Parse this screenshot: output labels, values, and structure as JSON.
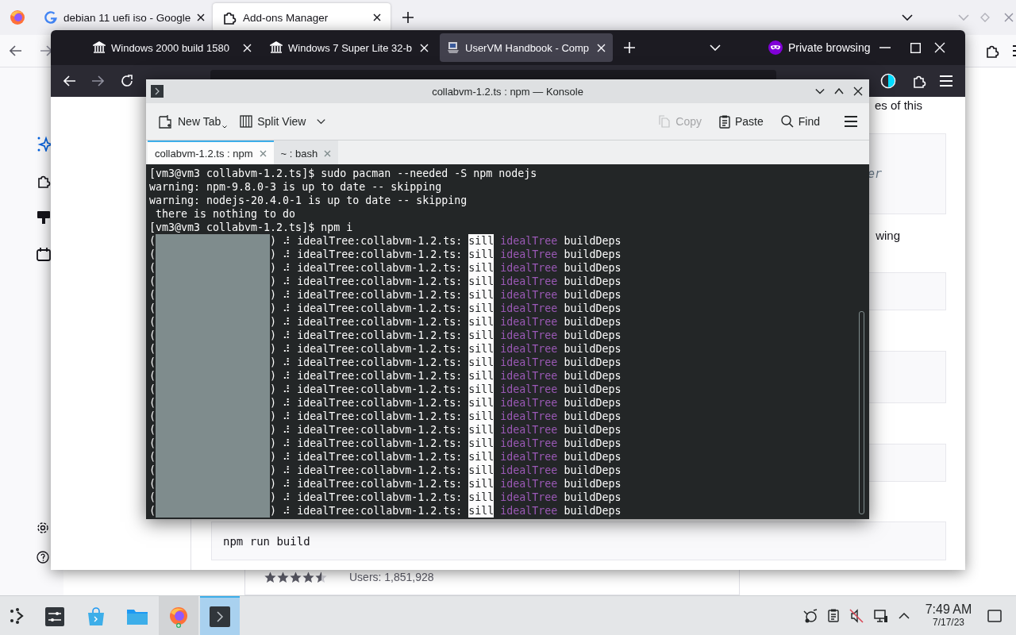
{
  "back_browser": {
    "tabs": [
      {
        "title": "debian 11 uefi iso - Google",
        "selected": false
      },
      {
        "title": "Add-ons Manager",
        "selected": true
      }
    ],
    "addon_card": {
      "stars": 4.5,
      "users": "Users: 1,851,928"
    }
  },
  "private_browser": {
    "tabs": [
      {
        "title": "Windows 2000 build 1580",
        "selected": false
      },
      {
        "title": "Windows 7 Super Lite 32-b",
        "selected": false
      },
      {
        "title": "UserVM Handbook - Comp",
        "selected": true
      }
    ],
    "private_label": "Private browsing",
    "page": {
      "paragraph_1": "es of this",
      "code_1": "er",
      "paragraph_2": "wing",
      "code_5": "npm run build"
    }
  },
  "konsole": {
    "title": "collabvm-1.2.ts : npm — Konsole",
    "toolbar": [
      {
        "label": "New Tab",
        "disabled": false
      },
      {
        "label": "Split View",
        "disabled": false
      },
      {
        "label": "Copy",
        "disabled": true
      },
      {
        "label": "Paste",
        "disabled": false
      },
      {
        "label": "Find",
        "disabled": false
      }
    ],
    "tabs": [
      {
        "label": "collabvm-1.2.ts : npm",
        "selected": true
      },
      {
        "label": "~ : bash",
        "selected": false
      }
    ],
    "lines": [
      {
        "kind": "text",
        "text": "[vm3@vm3 collabvm-1.2.ts]$ sudo pacman --needed -S npm nodejs"
      },
      {
        "kind": "text",
        "text": "warning: npm-9.8.0-3 is up to date -- skipping"
      },
      {
        "kind": "text",
        "text": "warning: nodejs-20.4.0-1 is up to date -- skipping"
      },
      {
        "kind": "text",
        "text": " there is nothing to do"
      },
      {
        "kind": "text",
        "text": "[vm3@vm3 collabvm-1.2.ts]$ npm i"
      },
      {
        "kind": "progress",
        "head": "(",
        "tail": ") ⠼ idealTree:collabvm-1.2.ts:",
        "loglevel": "sill",
        "module": "idealTree",
        "message": "buildDeps"
      },
      {
        "kind": "progress",
        "head": "(",
        "tail": ") ⠼ idealTree:collabvm-1.2.ts:",
        "loglevel": "sill",
        "module": "idealTree",
        "message": "buildDeps"
      },
      {
        "kind": "progress",
        "head": "(",
        "tail": ") ⠼ idealTree:collabvm-1.2.ts:",
        "loglevel": "sill",
        "module": "idealTree",
        "message": "buildDeps"
      },
      {
        "kind": "progress",
        "head": "(",
        "tail": ") ⠼ idealTree:collabvm-1.2.ts:",
        "loglevel": "sill",
        "module": "idealTree",
        "message": "buildDeps"
      },
      {
        "kind": "progress",
        "head": "(",
        "tail": ") ⠼ idealTree:collabvm-1.2.ts:",
        "loglevel": "sill",
        "module": "idealTree",
        "message": "buildDeps"
      },
      {
        "kind": "progress",
        "head": "(",
        "tail": ") ⠼ idealTree:collabvm-1.2.ts:",
        "loglevel": "sill",
        "module": "idealTree",
        "message": "buildDeps"
      },
      {
        "kind": "progress",
        "head": "(",
        "tail": ") ⠼ idealTree:collabvm-1.2.ts:",
        "loglevel": "sill",
        "module": "idealTree",
        "message": "buildDeps"
      },
      {
        "kind": "progress",
        "head": "(",
        "tail": ") ⠼ idealTree:collabvm-1.2.ts:",
        "loglevel": "sill",
        "module": "idealTree",
        "message": "buildDeps"
      },
      {
        "kind": "progress",
        "head": "(",
        "tail": ") ⠼ idealTree:collabvm-1.2.ts:",
        "loglevel": "sill",
        "module": "idealTree",
        "message": "buildDeps"
      },
      {
        "kind": "progress",
        "head": "(",
        "tail": ") ⠼ idealTree:collabvm-1.2.ts:",
        "loglevel": "sill",
        "module": "idealTree",
        "message": "buildDeps"
      },
      {
        "kind": "progress",
        "head": "(",
        "tail": ") ⠼ idealTree:collabvm-1.2.ts:",
        "loglevel": "sill",
        "module": "idealTree",
        "message": "buildDeps"
      },
      {
        "kind": "progress",
        "head": "(",
        "tail": ") ⠼ idealTree:collabvm-1.2.ts:",
        "loglevel": "sill",
        "module": "idealTree",
        "message": "buildDeps"
      },
      {
        "kind": "progress",
        "head": "(",
        "tail": ") ⠼ idealTree:collabvm-1.2.ts:",
        "loglevel": "sill",
        "module": "idealTree",
        "message": "buildDeps"
      },
      {
        "kind": "progress",
        "head": "(",
        "tail": ") ⠼ idealTree:collabvm-1.2.ts:",
        "loglevel": "sill",
        "module": "idealTree",
        "message": "buildDeps"
      },
      {
        "kind": "progress",
        "head": "(",
        "tail": ") ⠼ idealTree:collabvm-1.2.ts:",
        "loglevel": "sill",
        "module": "idealTree",
        "message": "buildDeps"
      },
      {
        "kind": "progress",
        "head": "(",
        "tail": ") ⠼ idealTree:collabvm-1.2.ts:",
        "loglevel": "sill",
        "module": "idealTree",
        "message": "buildDeps"
      },
      {
        "kind": "progress",
        "head": "(",
        "tail": ") ⠼ idealTree:collabvm-1.2.ts:",
        "loglevel": "sill",
        "module": "idealTree",
        "message": "buildDeps"
      },
      {
        "kind": "progress",
        "head": "(",
        "tail": ") ⠼ idealTree:collabvm-1.2.ts:",
        "loglevel": "sill",
        "module": "idealTree",
        "message": "buildDeps"
      },
      {
        "kind": "progress",
        "head": "(",
        "tail": ") ⠼ idealTree:collabvm-1.2.ts:",
        "loglevel": "sill",
        "module": "idealTree",
        "message": "buildDeps"
      },
      {
        "kind": "progress",
        "head": "(",
        "tail": ") ⠼ idealTree:collabvm-1.2.ts:",
        "loglevel": "sill",
        "module": "idealTree",
        "message": "buildDeps"
      },
      {
        "kind": "progress",
        "head": "(",
        "tail": ") ⠼ idealTree:collabvm-1.2.ts:",
        "loglevel": "sill",
        "module": "idealTree",
        "message": "buildDeps"
      }
    ]
  },
  "taskbar": {
    "apps": [
      {
        "running": false,
        "selected": false
      },
      {
        "running": false,
        "selected": false
      },
      {
        "running": false,
        "selected": false
      },
      {
        "running": true,
        "selected": false
      },
      {
        "running": true,
        "selected": true
      }
    ],
    "clock": {
      "time": "7:49 AM",
      "date": "7/17/23"
    }
  }
}
